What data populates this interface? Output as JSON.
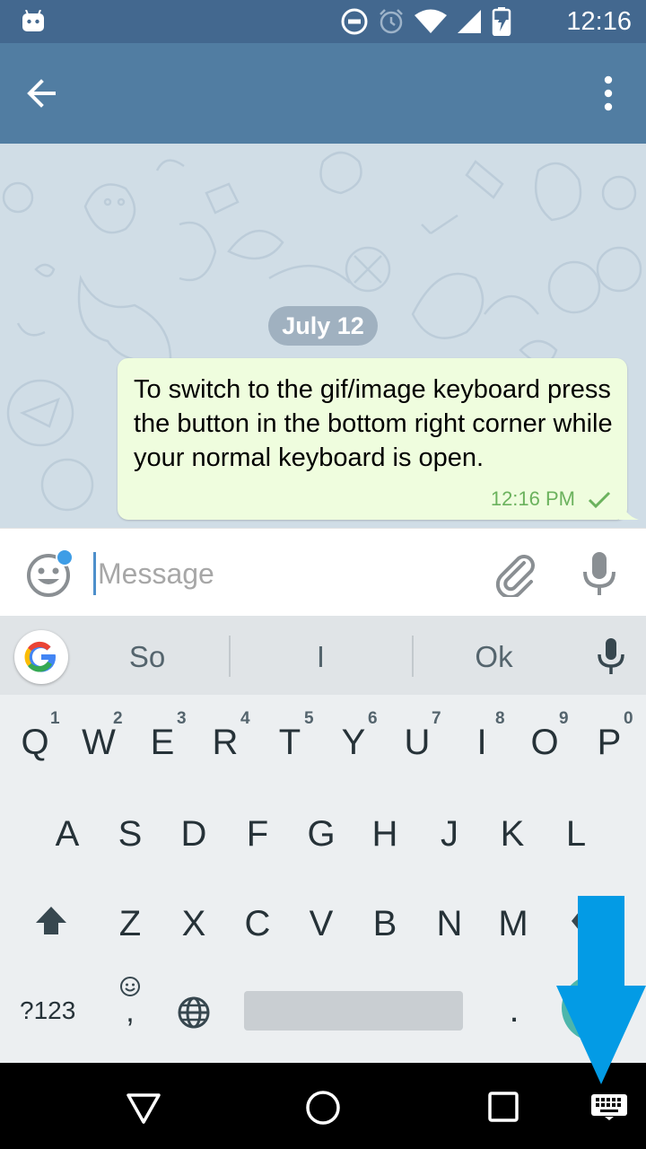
{
  "status_bar": {
    "time": "12:16"
  },
  "chat": {
    "date_label": "July 12",
    "message": {
      "text": "To switch to the gif/image keyboard press the button in the bottom right corner while your normal keyboard is open.",
      "time": "12:16 PM"
    }
  },
  "input": {
    "placeholder": "Message"
  },
  "keyboard": {
    "suggestions": [
      "So",
      "I",
      "Ok"
    ],
    "row1": [
      "Q",
      "W",
      "E",
      "R",
      "T",
      "Y",
      "U",
      "I",
      "O",
      "P"
    ],
    "row1_hints": [
      "1",
      "2",
      "3",
      "4",
      "5",
      "6",
      "7",
      "8",
      "9",
      "0"
    ],
    "row2": [
      "A",
      "S",
      "D",
      "F",
      "G",
      "H",
      "J",
      "K",
      "L"
    ],
    "row3": [
      "Z",
      "X",
      "C",
      "V",
      "B",
      "N",
      "M"
    ],
    "symbols_label": "?123",
    "comma": ",",
    "period": "."
  },
  "colors": {
    "status_bar": "#43688f",
    "toolbar": "#517da2",
    "outgoing_bubble": "#effdde",
    "arrow": "#039be5"
  }
}
